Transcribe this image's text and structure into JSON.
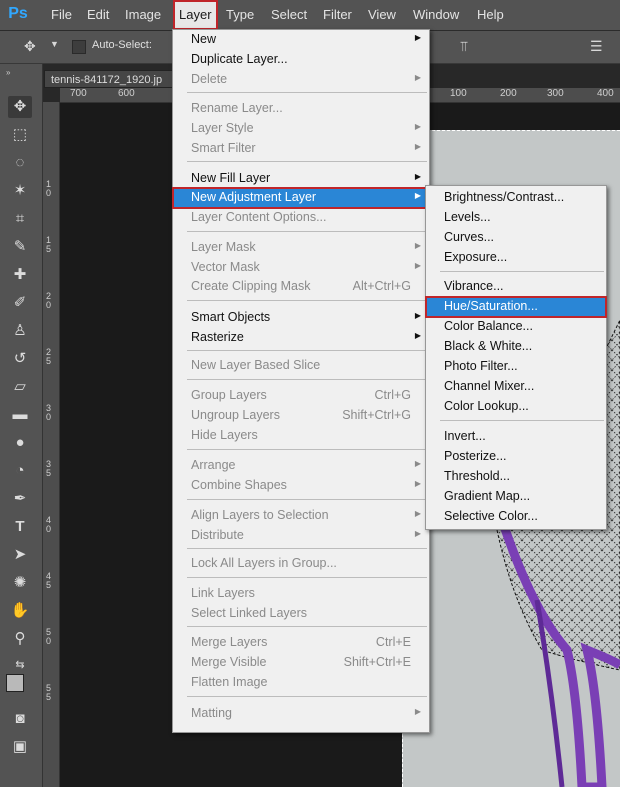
{
  "app": {
    "logo": "Ps"
  },
  "menubar": [
    "File",
    "Edit",
    "Image",
    "Layer",
    "Type",
    "Select",
    "Filter",
    "View",
    "Window",
    "Help"
  ],
  "options": {
    "auto_select_label": "Auto-Select:"
  },
  "document": {
    "tab_title": "tennis-841172_1920.jp",
    "ruler_h": [
      "700",
      "600",
      "100",
      "200",
      "300",
      "400"
    ],
    "ruler_v": [
      "1 0",
      "1 5",
      "2 0",
      "2 5",
      "3 0",
      "3 5",
      "4 0",
      "4 5",
      "5 0",
      "5 5"
    ]
  },
  "layer_menu": {
    "items": [
      {
        "label": "New",
        "submenu": true,
        "disabled": false,
        "shortcut": ""
      },
      {
        "label": "Duplicate Layer...",
        "submenu": false,
        "disabled": false,
        "shortcut": ""
      },
      {
        "label": "Delete",
        "submenu": true,
        "disabled": true,
        "shortcut": ""
      },
      {
        "label": "Rename Layer...",
        "submenu": false,
        "disabled": true,
        "shortcut": ""
      },
      {
        "label": "Layer Style",
        "submenu": true,
        "disabled": true,
        "shortcut": ""
      },
      {
        "label": "Smart Filter",
        "submenu": true,
        "disabled": true,
        "shortcut": ""
      },
      {
        "label": "New Fill Layer",
        "submenu": true,
        "disabled": false,
        "shortcut": ""
      },
      {
        "label": "New Adjustment Layer",
        "submenu": true,
        "disabled": false,
        "shortcut": ""
      },
      {
        "label": "Layer Content Options...",
        "submenu": false,
        "disabled": true,
        "shortcut": ""
      },
      {
        "label": "Layer Mask",
        "submenu": true,
        "disabled": true,
        "shortcut": ""
      },
      {
        "label": "Vector Mask",
        "submenu": true,
        "disabled": true,
        "shortcut": ""
      },
      {
        "label": "Create Clipping Mask",
        "submenu": false,
        "disabled": true,
        "shortcut": "Alt+Ctrl+G"
      },
      {
        "label": "Smart Objects",
        "submenu": true,
        "disabled": false,
        "shortcut": ""
      },
      {
        "label": "Rasterize",
        "submenu": true,
        "disabled": false,
        "shortcut": ""
      },
      {
        "label": "New Layer Based Slice",
        "submenu": false,
        "disabled": true,
        "shortcut": ""
      },
      {
        "label": "Group Layers",
        "submenu": false,
        "disabled": true,
        "shortcut": "Ctrl+G"
      },
      {
        "label": "Ungroup Layers",
        "submenu": false,
        "disabled": true,
        "shortcut": "Shift+Ctrl+G"
      },
      {
        "label": "Hide Layers",
        "submenu": false,
        "disabled": true,
        "shortcut": ""
      },
      {
        "label": "Arrange",
        "submenu": true,
        "disabled": true,
        "shortcut": ""
      },
      {
        "label": "Combine Shapes",
        "submenu": true,
        "disabled": true,
        "shortcut": ""
      },
      {
        "label": "Align Layers to Selection",
        "submenu": true,
        "disabled": true,
        "shortcut": ""
      },
      {
        "label": "Distribute",
        "submenu": true,
        "disabled": true,
        "shortcut": ""
      },
      {
        "label": "Lock All Layers in Group...",
        "submenu": false,
        "disabled": true,
        "shortcut": ""
      },
      {
        "label": "Link Layers",
        "submenu": false,
        "disabled": true,
        "shortcut": ""
      },
      {
        "label": "Select Linked Layers",
        "submenu": false,
        "disabled": true,
        "shortcut": ""
      },
      {
        "label": "Merge Layers",
        "submenu": false,
        "disabled": true,
        "shortcut": "Ctrl+E"
      },
      {
        "label": "Merge Visible",
        "submenu": false,
        "disabled": true,
        "shortcut": "Shift+Ctrl+E"
      },
      {
        "label": "Flatten Image",
        "submenu": false,
        "disabled": true,
        "shortcut": ""
      },
      {
        "label": "Matting",
        "submenu": true,
        "disabled": true,
        "shortcut": ""
      }
    ]
  },
  "adjustment_submenu": {
    "items": [
      "Brightness/Contrast...",
      "Levels...",
      "Curves...",
      "Exposure...",
      "Vibrance...",
      "Hue/Saturation...",
      "Color Balance...",
      "Black & White...",
      "Photo Filter...",
      "Channel Mixer...",
      "Color Lookup...",
      "Invert...",
      "Posterize...",
      "Threshold...",
      "Gradient Map...",
      "Selective Color..."
    ]
  },
  "colors": {
    "highlight": "#2a86d6",
    "callout": "#c0252a"
  },
  "tools": [
    "move-icon",
    "marquee-icon",
    "lasso-icon",
    "magic-wand-icon",
    "crop-icon",
    "eyedropper-icon",
    "healing-brush-icon",
    "brush-icon",
    "clone-stamp-icon",
    "history-brush-icon",
    "eraser-icon",
    "gradient-icon",
    "blur-icon",
    "dodge-icon",
    "pen-icon",
    "type-icon",
    "path-select-icon",
    "shape-icon",
    "hand-icon",
    "zoom-icon",
    "swap-colors-icon",
    "color-swatches-icon",
    "quick-mask-icon",
    "screen-mode-icon"
  ]
}
